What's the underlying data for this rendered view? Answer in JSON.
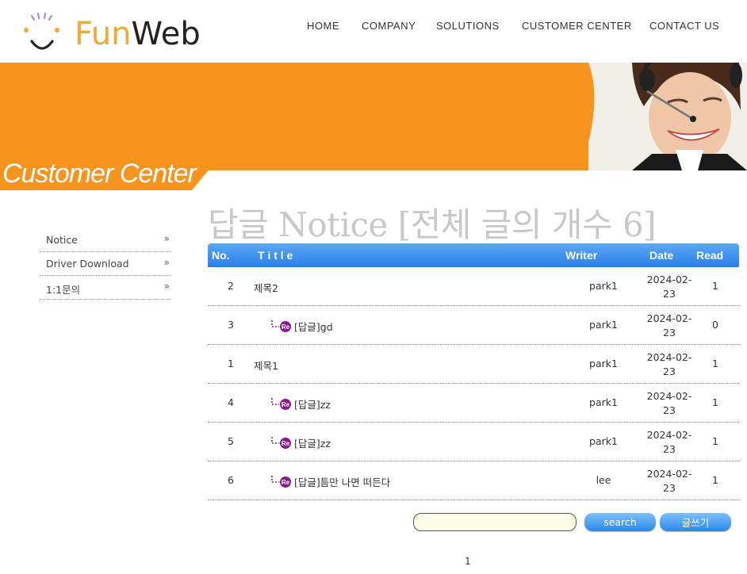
{
  "header": {
    "logo": {
      "fun": "Fun",
      "web": "Web"
    },
    "nav": [
      "HOME",
      "COMPANY",
      "SOLUTIONS",
      "CUSTOMER CENTER",
      "CONTACT US"
    ]
  },
  "banner": {
    "title": "Customer Center"
  },
  "sidebar": {
    "items": [
      {
        "label": "Notice",
        "arrow": "»"
      },
      {
        "label": "Driver Download",
        "arrow": "»"
      },
      {
        "label": "1:1문의",
        "arrow": "»"
      }
    ]
  },
  "page": {
    "heading": "답글 Notice [전체 글의 개수 6]"
  },
  "board": {
    "headers": {
      "no": "No.",
      "title": "T i t l e",
      "writer": "Writer",
      "date": "Date",
      "read": "Read"
    },
    "rows": [
      {
        "no": "2",
        "title": "제목2",
        "reply": false,
        "writer": "park1",
        "date_line1": "2024-02-",
        "date_line2": "23",
        "read": "1"
      },
      {
        "no": "3",
        "title": "[답글]gd",
        "reply": true,
        "writer": "park1",
        "date_line1": "2024-02-",
        "date_line2": "23",
        "read": "0"
      },
      {
        "no": "1",
        "title": "제목1",
        "reply": false,
        "writer": "park1",
        "date_line1": "2024-02-",
        "date_line2": "23",
        "read": "1"
      },
      {
        "no": "4",
        "title": "[답글]zz",
        "reply": true,
        "writer": "park1",
        "date_line1": "2024-02-",
        "date_line2": "23",
        "read": "1"
      },
      {
        "no": "5",
        "title": "[답글]zz",
        "reply": true,
        "writer": "park1",
        "date_line1": "2024-02-",
        "date_line2": "23",
        "read": "1"
      },
      {
        "no": "6",
        "title": "[답글]틈만 나면 떠든다",
        "reply": true,
        "writer": "lee",
        "date_line1": "2024-02-",
        "date_line2": "23",
        "read": "1"
      }
    ]
  },
  "search": {
    "value": "",
    "button_label": "search",
    "write_label": "글쓰기"
  },
  "pagination": {
    "current": "1"
  },
  "colors": {
    "accent_orange": "#f7941e",
    "header_blue": "#2b7de6",
    "reply_icon_purple": "#8a1a8a"
  },
  "icons": [
    "reply-icon",
    "double-chevron-icon"
  ]
}
